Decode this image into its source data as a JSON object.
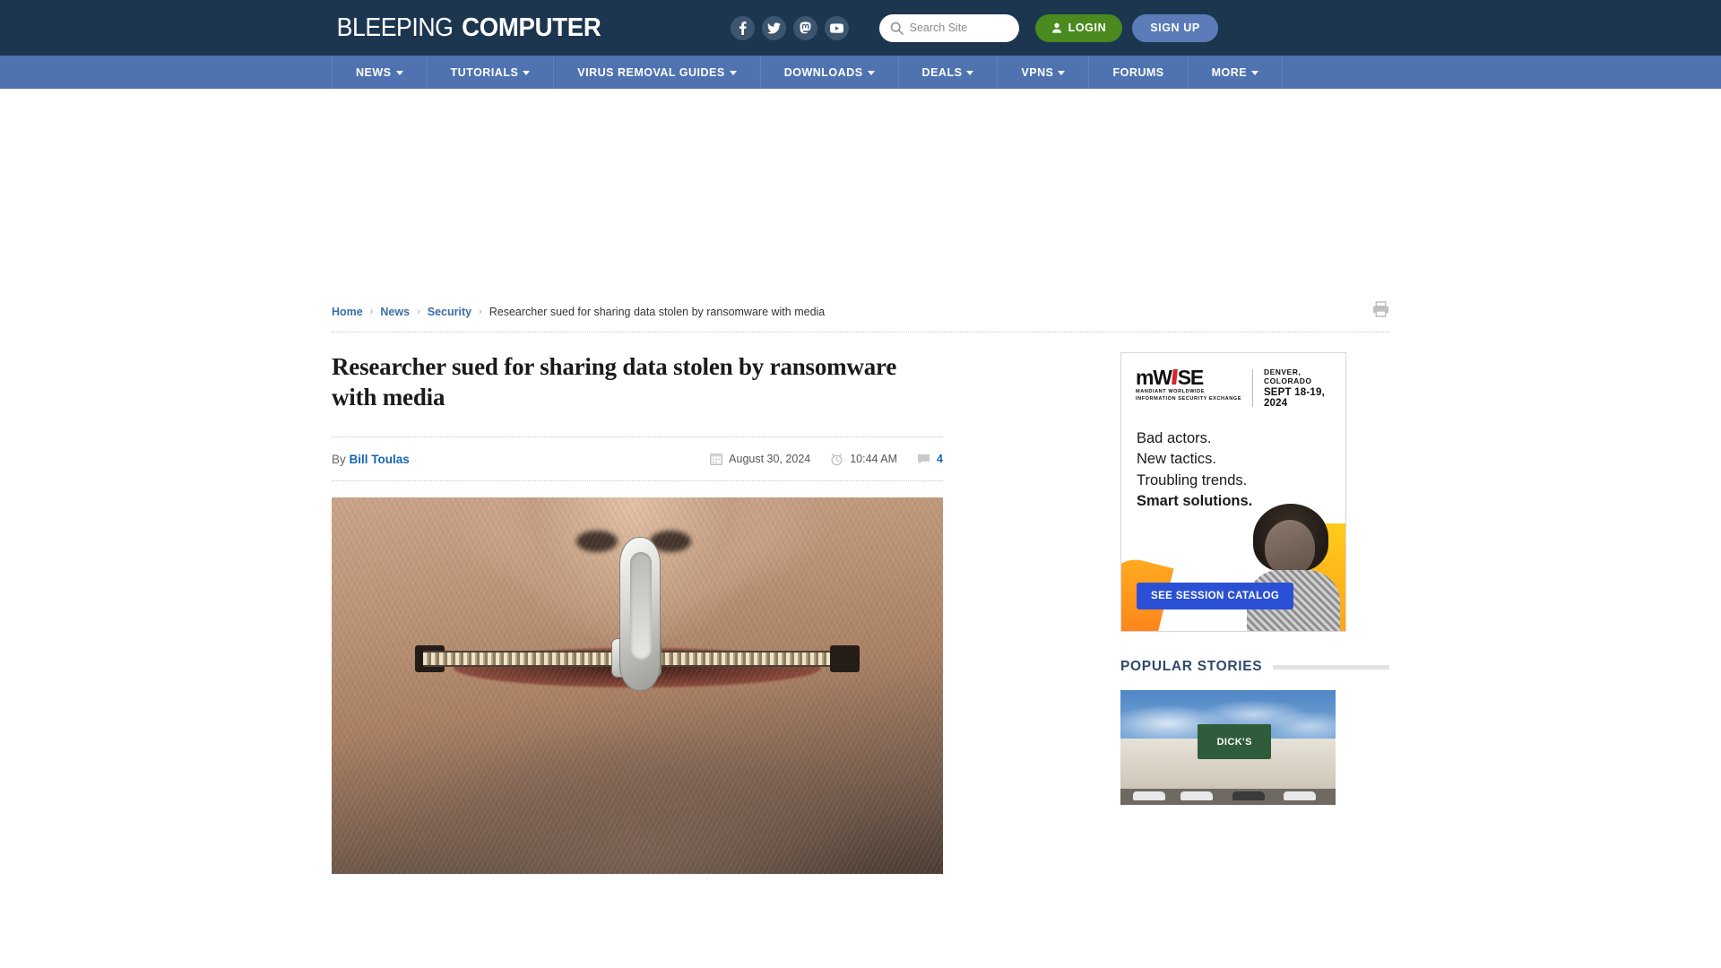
{
  "header": {
    "logo_light": "BLEEPING",
    "logo_bold": "COMPUTER",
    "social": [
      {
        "name": "facebook-icon",
        "label": "Facebook"
      },
      {
        "name": "twitter-icon",
        "label": "Twitter"
      },
      {
        "name": "mastodon-icon",
        "label": "Mastodon"
      },
      {
        "name": "youtube-icon",
        "label": "YouTube"
      }
    ],
    "search": {
      "placeholder": "Search Site",
      "value": ""
    },
    "login_label": "LOGIN",
    "signup_label": "SIGN UP",
    "colors": {
      "header_bg": "#1d3650",
      "nav_bg": "#4f73b0",
      "login_green": "#4a8a1f",
      "signup_blue": "#5b7cb8"
    }
  },
  "nav": {
    "items": [
      {
        "label": "NEWS",
        "has_caret": true
      },
      {
        "label": "TUTORIALS",
        "has_caret": true
      },
      {
        "label": "VIRUS REMOVAL GUIDES",
        "has_caret": true
      },
      {
        "label": "DOWNLOADS",
        "has_caret": true
      },
      {
        "label": "DEALS",
        "has_caret": true
      },
      {
        "label": "VPNS",
        "has_caret": true
      },
      {
        "label": "FORUMS",
        "has_caret": false
      },
      {
        "label": "MORE",
        "has_caret": true
      }
    ]
  },
  "breadcrumb": {
    "links": [
      "Home",
      "News",
      "Security"
    ],
    "separator": "›",
    "current": "Researcher sued for sharing data stolen by ransomware with media"
  },
  "article": {
    "title": "Researcher sued for sharing data stolen by ransomware with media",
    "by_prefix": "By",
    "author": "Bill Toulas",
    "date": "August 30, 2024",
    "time": "10:44 AM",
    "comment_count": "4"
  },
  "sidebar": {
    "ad": {
      "brand_m": "m",
      "brand_w": "W",
      "brand_se": "SE",
      "sub_line1": "MANDIANT WORLDWIDE",
      "sub_line2": "INFORMATION SECURITY EXCHANGE",
      "city": "DENVER, COLORADO",
      "date": "SEPT 18-19, 2024",
      "lines": [
        "Bad actors.",
        "New tactics.",
        "Troubling trends."
      ],
      "line_strong": "Smart solutions.",
      "cta": "SEE SESSION CATALOG"
    },
    "popular": {
      "heading": "POPULAR STORIES",
      "thumb_sign_text": "DICK'S"
    }
  }
}
